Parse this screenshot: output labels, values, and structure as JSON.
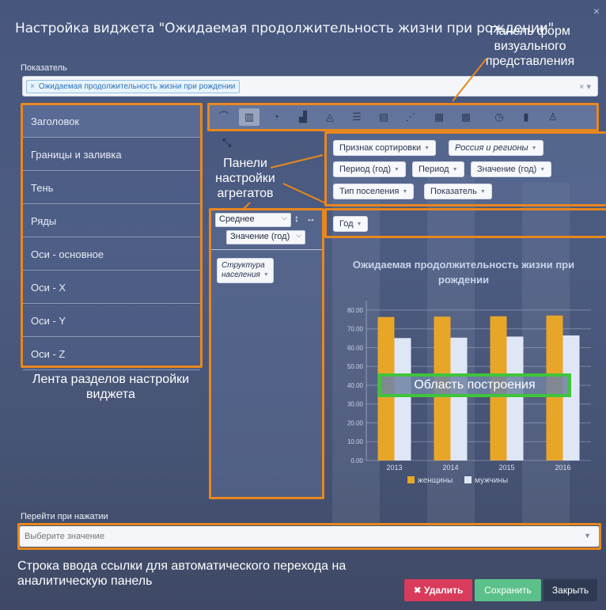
{
  "dialog": {
    "title": "Настройка виджета \"Ожидаемая продолжительность жизни при рождении\"",
    "close_icon": "×"
  },
  "indicator": {
    "label": "Показатель",
    "tag_remove": "×",
    "tag": "Ожидаемая продолжительность жизни при рождении",
    "clear_icon": "× ▾"
  },
  "sidebar": {
    "items": [
      {
        "label": "Заголовок"
      },
      {
        "label": "Границы и заливка"
      },
      {
        "label": "Тень"
      },
      {
        "label": "Ряды"
      },
      {
        "label": "Оси - основное"
      },
      {
        "label": "Оси - X"
      },
      {
        "label": "Оси - Y"
      },
      {
        "label": "Оси - Z"
      }
    ]
  },
  "chart_types": [
    "line-chart-icon",
    "bar-chart-icon",
    "pie-chart-icon",
    "stacked-bar-icon",
    "area-chart-icon",
    "horizontal-bar-icon",
    "combo-chart-icon",
    "scatter-chart-icon",
    "grouped-bar-icon",
    "table-icon",
    "gauge-icon",
    "bullet-chart-icon",
    "map-icon"
  ],
  "aggregates": {
    "row1": [
      "Признак сортировки",
      "Россия и регионы"
    ],
    "row2": [
      "Период (год)",
      "Период",
      "Значение (год)"
    ],
    "row3": [
      "Тип поселения",
      "Показатель"
    ],
    "filter": "Год",
    "function_select": "Среднее",
    "value_select": "Значение (год)",
    "structure_tag": "Структура населения"
  },
  "callouts": {
    "forms_panel": "Панель форм визуального представления",
    "agg_panels": "Панели настройки агрегатов",
    "sections_ribbon": "Лента разделов настройки виджета",
    "plot_area": "Область построения",
    "link_row": "Строка ввода ссылки для автоматического перехода на аналитическую панель"
  },
  "navigate": {
    "label": "Перейти при нажатии",
    "placeholder": "Выберите значение"
  },
  "buttons": {
    "delete": "✖ Удалить",
    "save": "Сохранить",
    "close": "Закрыть"
  },
  "colors": {
    "accent_orange": "#e8871e",
    "women": "#e8a628",
    "men": "#dfe7f7",
    "delete": "#d93b5b",
    "save": "#5cc08a",
    "close": "#2e3a52",
    "highlight_green": "#3fc43b"
  },
  "chart_data": {
    "type": "bar",
    "title": "Ожидаемая продолжительность жизни при рождении",
    "categories": [
      "2013",
      "2014",
      "2015",
      "2016"
    ],
    "series": [
      {
        "name": "женщины",
        "values": [
          76.3,
          76.5,
          76.7,
          77.1
        ]
      },
      {
        "name": "мужчины",
        "values": [
          65.1,
          65.3,
          65.9,
          66.5
        ]
      }
    ],
    "y_ticks": [
      "0.00",
      "10.00",
      "20.00",
      "30.00",
      "40.00",
      "50.00",
      "60.00",
      "70.00",
      "80.00"
    ],
    "ylim": [
      0,
      85
    ],
    "grid": true,
    "legend": "bottom"
  }
}
